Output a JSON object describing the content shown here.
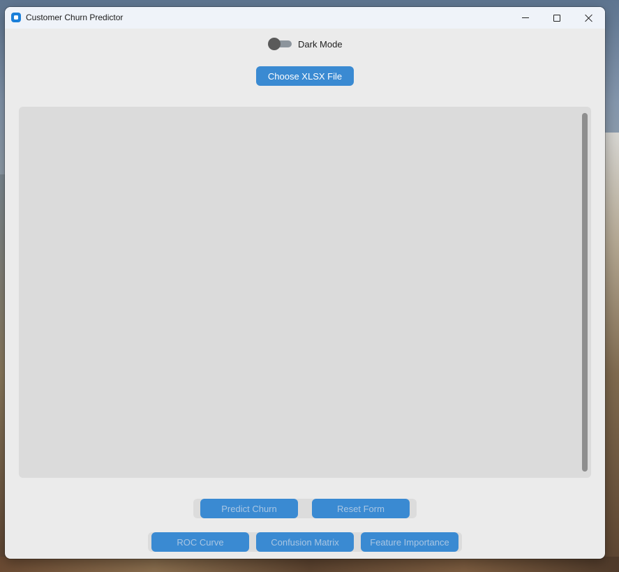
{
  "window": {
    "title": "Customer Churn Predictor",
    "controls": [
      "minimize-icon",
      "maximize-icon",
      "close-icon"
    ]
  },
  "theme_toggle": {
    "label": "Dark Mode",
    "on": false
  },
  "file_button": {
    "label": "Choose XLSX File"
  },
  "action_buttons": [
    {
      "label": "Predict Churn",
      "enabled": false
    },
    {
      "label": "Reset Form",
      "enabled": false
    }
  ],
  "chart_buttons": [
    {
      "label": "ROC Curve",
      "enabled": false
    },
    {
      "label": "Confusion Matrix",
      "enabled": false
    },
    {
      "label": "Feature Importance",
      "enabled": false
    }
  ],
  "colors": {
    "accent": "#3a8ad2",
    "window_bg": "#ebebeb",
    "panel_bg": "#dbdbdb",
    "disabled_text": "#a9c6e3"
  }
}
